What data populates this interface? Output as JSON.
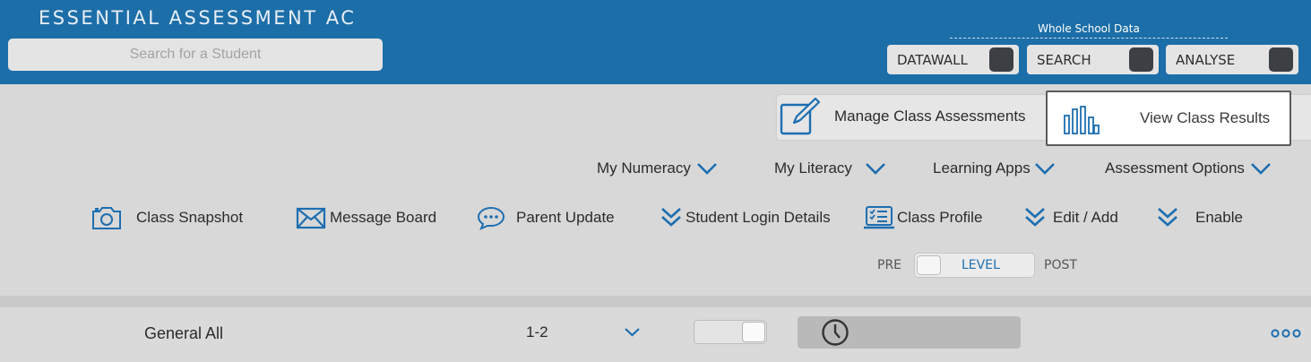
{
  "header": {
    "title": "ESSENTIAL ASSESSMENT AC",
    "search_placeholder": "Search for a Student",
    "whole_school_label": "Whole School Data",
    "buttons": [
      "DATAWALL",
      "SEARCH",
      "ANALYSE"
    ]
  },
  "class_tabs": {
    "manage_label": "Manage Class Assessments",
    "view_label": "View Class Results"
  },
  "menus": [
    "My Numeracy",
    "My Literacy",
    "Learning Apps",
    "Assessment Options"
  ],
  "tools": {
    "class_snapshot": "Class Snapshot",
    "message_board": "Message Board",
    "parent_update": "Parent Update",
    "student_login": "Student Login Details",
    "class_profile": "Class Profile",
    "edit_add": "Edit / Add",
    "enable": "Enable"
  },
  "level_toggle": {
    "pre": "PRE",
    "level": "LEVEL",
    "post": "POST"
  },
  "row": {
    "name": "General All",
    "range": "1-2"
  },
  "colors": {
    "header_bg": "#1c6ea8",
    "accent_blue": "#1d6eb0",
    "page_bg": "#d8d8d8"
  }
}
